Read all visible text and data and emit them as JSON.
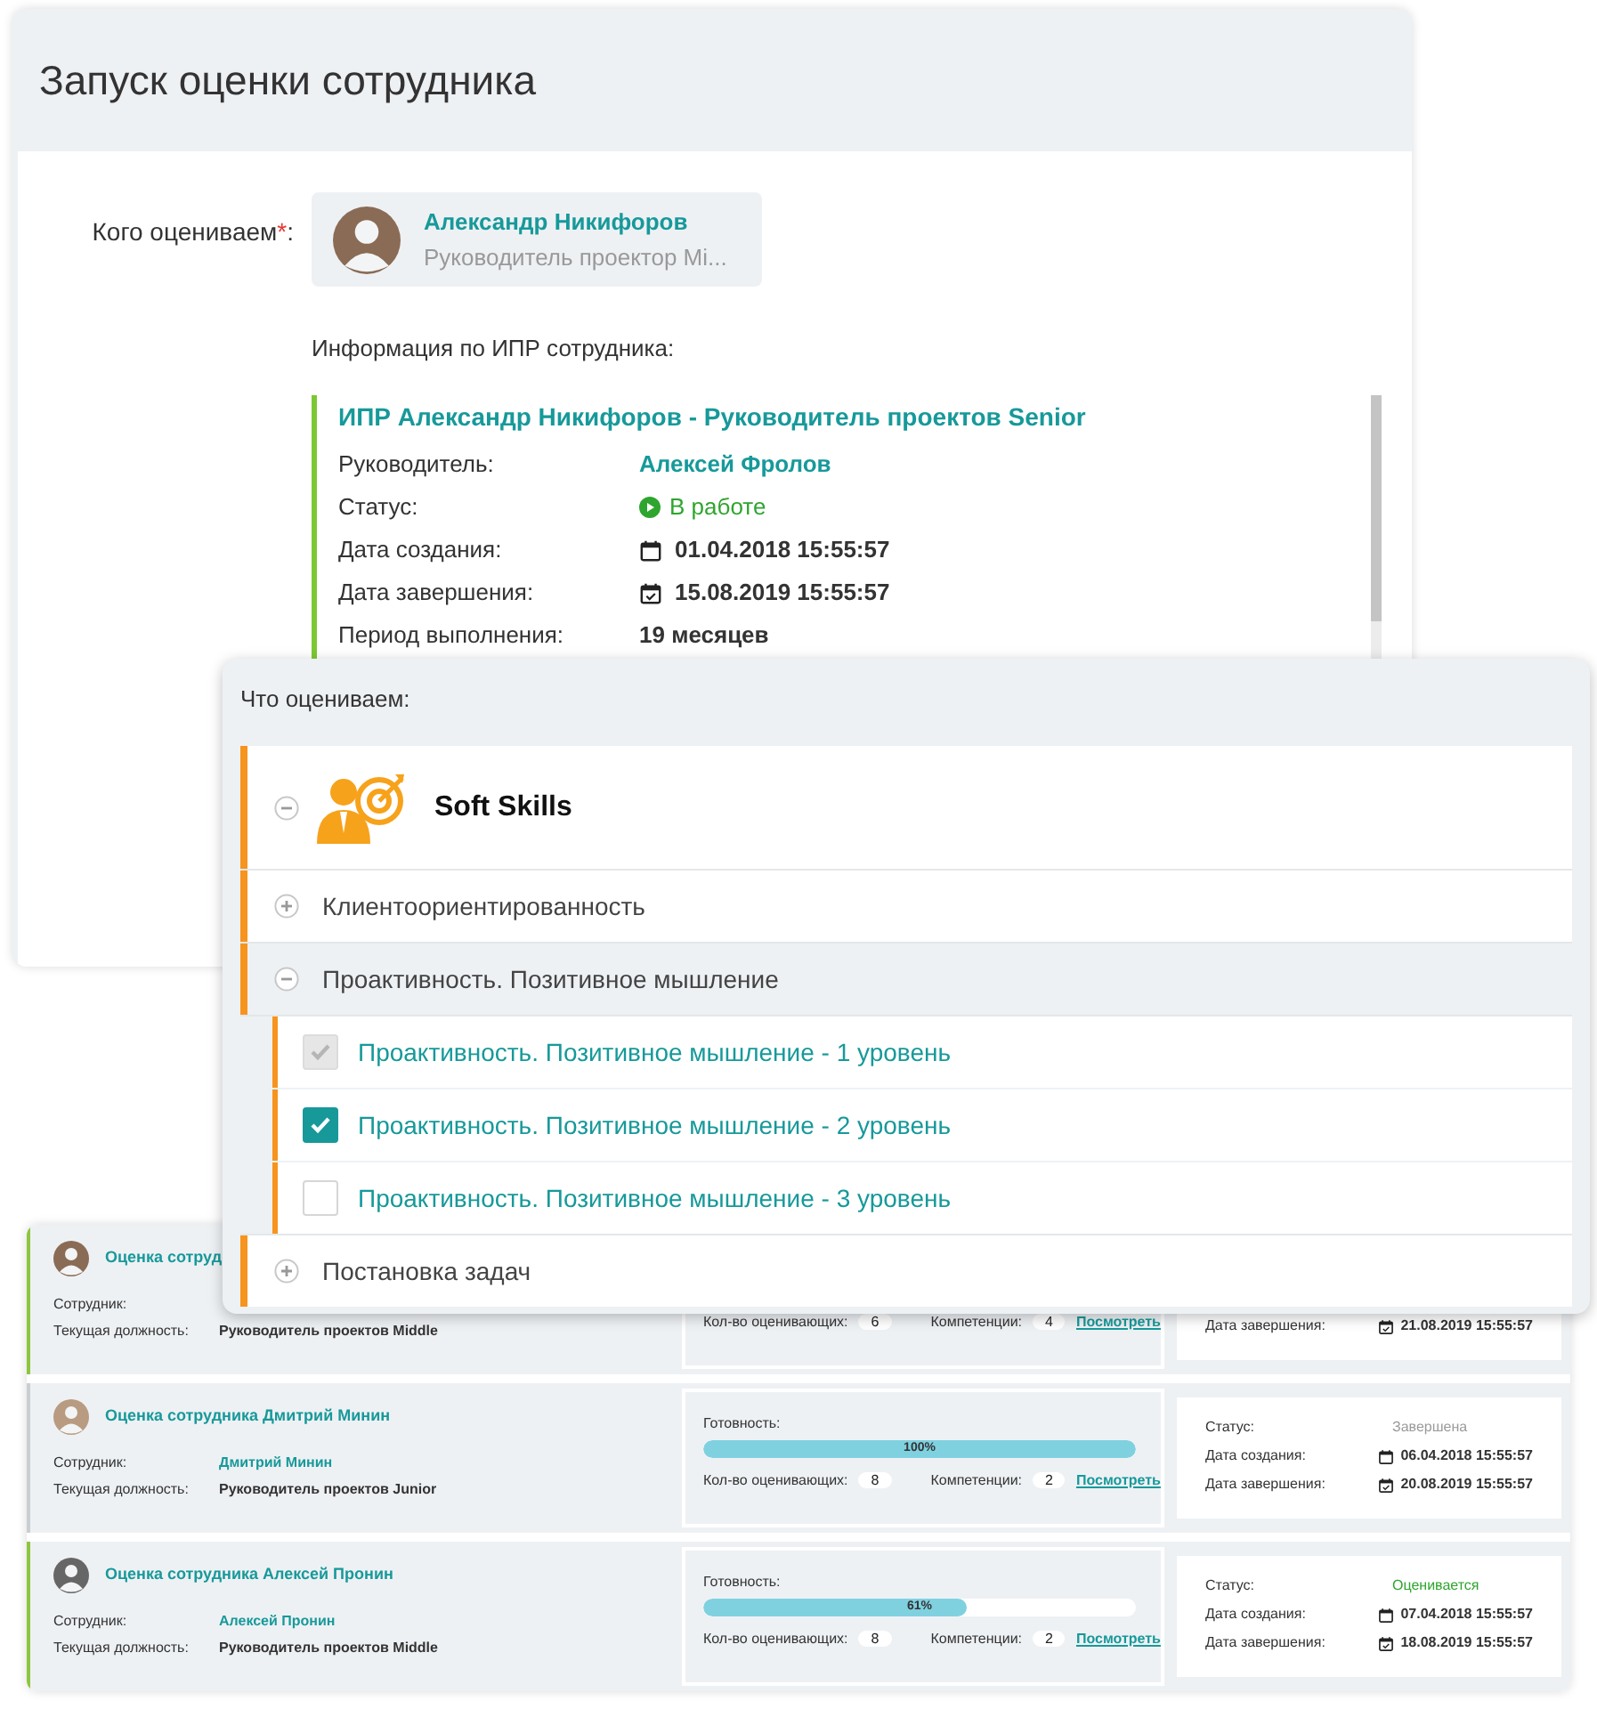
{
  "form": {
    "title": "Запуск оценки сотрудника",
    "who": {
      "label": "Кого оцениваем",
      "required_mark": "*",
      "colon": ":",
      "name": "Александр Никифоров",
      "position": "Руководитель проектор Mi..."
    },
    "ipr": {
      "heading": "Информация по ИПР сотрудника:",
      "title": "ИПР Александр Никифоров - Руководитель проектов Senior",
      "rows": [
        {
          "label": "Руководитель:",
          "value": "Алексей Фролов",
          "kind": "link"
        },
        {
          "label": "Статус:",
          "value": "В работе",
          "kind": "status"
        },
        {
          "label": "Дата создания:",
          "value": "01.04.2018 15:55:57",
          "kind": "date"
        },
        {
          "label": "Дата завершения:",
          "value": "15.08.2019 15:55:57",
          "kind": "due"
        },
        {
          "label": "Период выполнения:",
          "value": "19 месяцев",
          "kind": "text"
        }
      ]
    }
  },
  "dialog": {
    "heading": "Что оцениваем:",
    "group": {
      "title": "Soft Skills",
      "expanded": true,
      "items": [
        {
          "label": "Клиентоориентированность",
          "expanded": false
        },
        {
          "label": "Проактивность. Позитивное мышление",
          "expanded": true,
          "children": [
            {
              "label": "Проактивность. Позитивное мышление - 1 уровень",
              "checked": true,
              "disabled": true
            },
            {
              "label": "Проактивность. Позитивное мышление - 2 уровень",
              "checked": true,
              "disabled": false
            },
            {
              "label": "Проактивность. Позитивное мышление - 3 уровень",
              "checked": false,
              "disabled": false
            }
          ]
        },
        {
          "label": "Постановка задач",
          "expanded": false
        }
      ]
    }
  },
  "evaluations": [
    {
      "color": "#8dc63f",
      "title": "Оценка сотруд",
      "employee_label": "Сотрудник:",
      "position_label": "Текущая должность:",
      "position": "Руководитель проектов Middle",
      "raters_label": "Кол-во оценивающих:",
      "raters": "6",
      "competencies_label": "Компетенции:",
      "competencies": "4",
      "link": "Посмотреть",
      "due_label": "Дата завершения:",
      "due": "21.08.2019 15:55:57"
    },
    {
      "color": "#c9ced3",
      "title": "Оценка сотрудника Дмитрий Минин",
      "employee_label": "Сотрудник:",
      "employee": "Дмитрий Минин",
      "position_label": "Текущая должность:",
      "position": "Руководитель проектов Junior",
      "readiness_label": "Готовность:",
      "level": 1,
      "readiness_value": "100%",
      "raters_label": "Кол-во оценивающих:",
      "raters": "8",
      "competencies_label": "Компетенции:",
      "competencies": "2",
      "link": "Посмотреть",
      "status_label": "Статус:",
      "status": {
        "text": "Завершена",
        "color": "#9a9a9a"
      },
      "created_label": "Дата создания:",
      "created": "06.04.2018 15:55:57",
      "due_label": "Дата завершения:",
      "due": "20.08.2019 15:55:57"
    },
    {
      "color": "#8dc63f",
      "title": "Оценка сотрудника Алексей Пронин",
      "employee_label": "Сотрудник:",
      "employee": "Алексей Пронин",
      "position_label": "Текущая должность:",
      "position": "Руководитель проектов Middle",
      "readiness_label": "Готовность:",
      "level": 0.61,
      "readiness_value": "61%",
      "raters_label": "Кол-во оценивающих:",
      "raters": "8",
      "competencies_label": "Компетенции:",
      "competencies": "2",
      "link": "Посмотреть",
      "status_label": "Статус:",
      "status": {
        "text": "Оценивается",
        "color": "#2ea52e"
      },
      "created_label": "Дата создания:",
      "created": "07.04.2018 15:55:57",
      "due_label": "Дата завершения:",
      "due": "18.08.2019 15:55:57"
    }
  ]
}
